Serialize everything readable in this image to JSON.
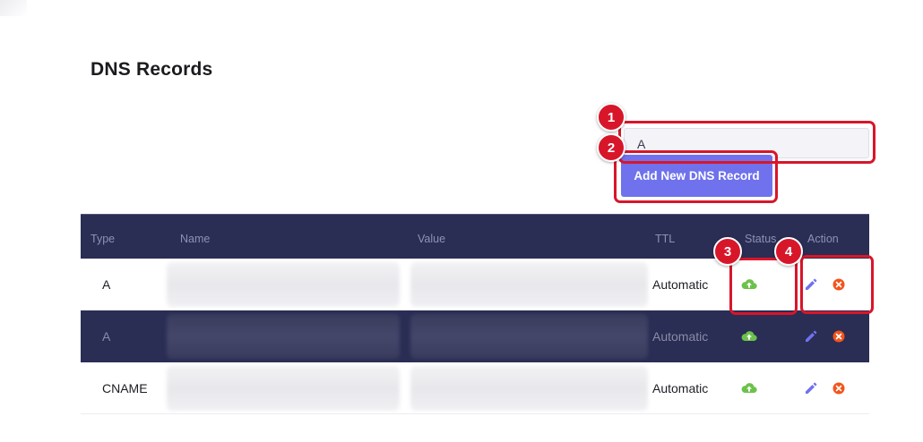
{
  "page": {
    "title": "DNS Records"
  },
  "form": {
    "type_value": "A",
    "add_button_label": "Add New DNS Record"
  },
  "table": {
    "columns": [
      "Type",
      "Name",
      "Value",
      "TTL",
      "Status",
      "Action"
    ],
    "rows": [
      {
        "type": "A",
        "ttl": "Automatic",
        "status_icon": "cloud-upload-icon",
        "row_style": "light"
      },
      {
        "type": "A",
        "ttl": "Automatic",
        "status_icon": "cloud-upload-icon",
        "row_style": "dark"
      },
      {
        "type": "CNAME",
        "ttl": "Automatic",
        "status_icon": "cloud-upload-icon",
        "row_style": "light"
      }
    ]
  },
  "annotations": [
    "1",
    "2",
    "3",
    "4"
  ],
  "colors": {
    "accent": "#6f72ec",
    "header_bg": "#2a2d54",
    "annotation": "#d8162a",
    "status_green": "#6cc24a",
    "edit_purple": "#6f72ec",
    "delete_orange": "#f2541b"
  }
}
